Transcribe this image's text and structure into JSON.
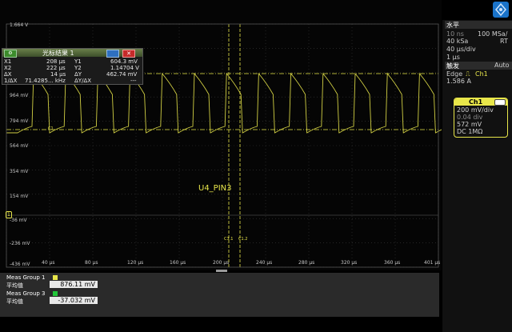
{
  "y_axis": [
    "1.664 V",
    "964 mV",
    "794 mV",
    "564 mV",
    "354 mV",
    "154 mV",
    "-36 mV",
    "-236 mV",
    "-436 mV"
  ],
  "x_axis": [
    "40 µs",
    "80 µs",
    "120 µs",
    "160 µs",
    "200 µs",
    "240 µs",
    "280 µs",
    "320 µs",
    "360 µs",
    "401 µs"
  ],
  "cursor_window": {
    "title": "光标结果 1",
    "x1_label": "X1",
    "x1_value": "208 µs",
    "y1_label": "Y1",
    "y1_value": "604.3 mV",
    "x2_label": "X2",
    "x2_value": "222 µs",
    "y2_label": "Y2",
    "y2_value": "1.14704 V",
    "dx_label": "ΔX",
    "dx_value": "14 µs",
    "dy_label": "ΔY",
    "dy_value": "462.74 mV",
    "inv_dx_label": "1/ΔX",
    "inv_dx_value": "71.4285... kHz",
    "dy_dx_label": "ΔY/ΔX",
    "dy_dx_value": "---"
  },
  "trace_label": "U4_PIN3",
  "marker_c1_1": "C1.1",
  "marker_c1_2": "C1.2",
  "marker_c1": "C1",
  "right_panel": {
    "horizontal_title": "水平",
    "time_scale": "10 ns",
    "sample_rate": "100 MSa/",
    "record": "40 kSa",
    "rt": "RT",
    "time_div": "40 µs/div",
    "position": "1 µs",
    "trigger_title": "触发",
    "trigger_mode": "Auto",
    "trigger_type": "Edge",
    "trigger_source": "Ch1",
    "trigger_level": "1.586 A",
    "ch1": {
      "name": "Ch1",
      "scale": "200 mV/div",
      "fine": "0.04 div",
      "offset": "572 mV",
      "coupling": "DC 1MΩ"
    }
  },
  "measurements": [
    {
      "group": "Meas Group 1",
      "stat": "平均值",
      "value": "876.11 mV",
      "color": "#e8e64a"
    },
    {
      "group": "Meas Group 3",
      "stat": "平均值",
      "value": "-37.032 mV",
      "color": "#22c63a"
    }
  ],
  "colors": {
    "trace": "#e8e64a",
    "grid": "#3a3a3a",
    "panel": "#111111",
    "accent_blue": "#1a73c9"
  }
}
